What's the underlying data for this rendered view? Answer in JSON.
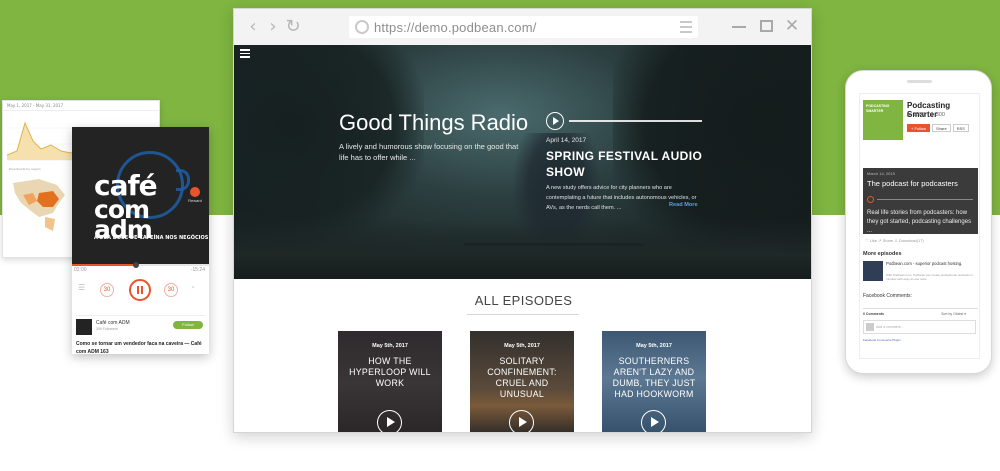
{
  "colors": {
    "green": "#7fb540",
    "orange": "#e8542d",
    "link_blue": "#4aa3ff"
  },
  "browser": {
    "url": "https://demo.podbean.com/",
    "icons": [
      "back-arrow-icon",
      "forward-arrow-icon",
      "reload-icon",
      "globe-icon",
      "menu-icon",
      "minimize-icon",
      "maximize-icon",
      "close-icon"
    ],
    "nav": {
      "back": "‹",
      "forward": "›",
      "reload": "↻",
      "close": "✕"
    }
  },
  "hero": {
    "title": "Good Things Radio",
    "description": "A lively and humorous show focusing on the good that life has to offer while ...",
    "featured": {
      "date": "April 14, 2017",
      "title": "SPRING FESTIVAL AUDIO SHOW",
      "description": "A new study offers advice for city planners who are contemplating a future that includes autonomous vehicles, or AVs, as the nerds call them. ...",
      "read_more": "Read More"
    }
  },
  "episodes_section": {
    "title": "ALL EPISODES",
    "items": [
      {
        "date": "May 5th, 2017",
        "title": "HOW THE HYPERLOOP WILL WORK",
        "bg": "linear-gradient(180deg,#2e2b2e 0%,#3a3536 50%,#2a2628 100%)"
      },
      {
        "date": "May 5th, 2017",
        "title": "SOLITARY CONFINEMENT: CRUEL AND UNUSUAL",
        "bg": "linear-gradient(180deg,#33302d 0%,#5a4a3b 55%,#7a5a3a 72%,#2d2a28 100%)"
      },
      {
        "date": "May 5th, 2017",
        "title": "SOUTHERNERS AREN'T LAZY AND DUMB, THEY JUST HAD HOOKWORM",
        "bg": "linear-gradient(180deg,#3d5872 0%,#5c7892 45%,#35506a 100%)"
      }
    ]
  },
  "analytics": {
    "header": "May 1, 2017 - May 31, 2017",
    "map_title": "Downloads by region"
  },
  "player": {
    "cover_lines": [
      "café",
      "com",
      "adm"
    ],
    "tagline": "A SUA DOSE DE CAFEÍNA NOS NEGÓCIOS",
    "reward_label": "Reward",
    "progress": 0.47,
    "time_elapsed": "02:00",
    "time_total": "-15:24",
    "skip_back": "30",
    "skip_forward": "30",
    "channel_name": "Café com ADM",
    "followers": "309 Followers",
    "follow_label": "Follow",
    "episode_title": "Como se tornar um vendedor faca na caveira — Café com ADM 163"
  },
  "phone": {
    "cover_lines": [
      "PODCASTING",
      "SMARTER"
    ],
    "title": "Podcasting Smarter",
    "likes": "▶ 1500",
    "downloads": "⇓ 300",
    "buttons": [
      "+ Follow",
      "Share",
      "RSS"
    ],
    "episode": {
      "date": "March 14, 2019",
      "title": "The podcast for podcasters",
      "description": "Real life stories from podcasters: how they got started, podcasting challenges ..."
    },
    "actions": "♡ Like   ↗ Share   ⇓ Download(17)",
    "more_episodes_label": "More episodes",
    "more_item_title": "Podbean.com - superior podcast hosting.",
    "more_item_sub": "With Podbean.com, Podbean can create professional podcasts in minutes with easy-to-use tools.",
    "facebook_label": "Facebook Comments:",
    "comments_count": "0 Comments",
    "sort_label": "Sort by  Oldest ▾",
    "comment_placeholder": "Add a comment...",
    "plugin_label": "Facebook Comments Plugin"
  }
}
